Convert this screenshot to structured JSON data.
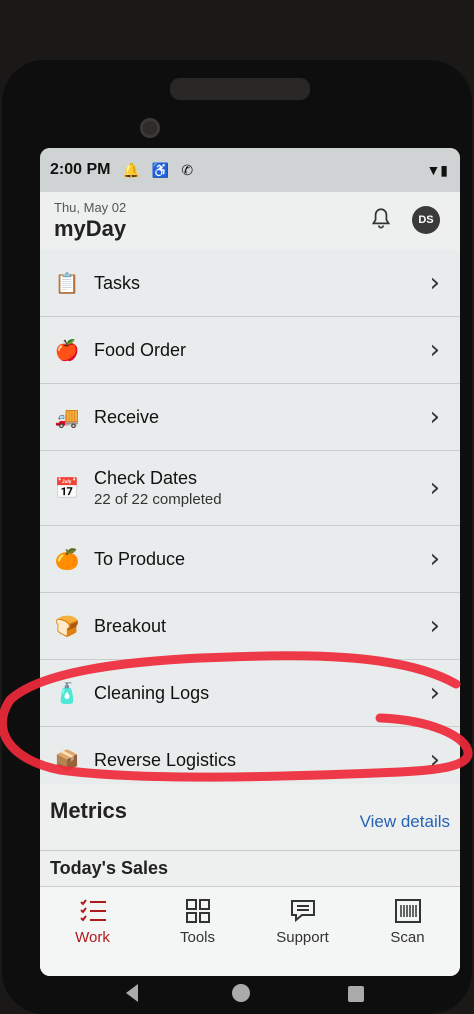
{
  "status": {
    "time": "2:00 PM",
    "icons": [
      "bell-icon",
      "accessibility-icon",
      "phone-icon"
    ],
    "right": "wifi-battery"
  },
  "header": {
    "date": "Thu, May 02",
    "title": "myDay",
    "avatar": "DS"
  },
  "menu": [
    {
      "label": "Tasks",
      "sub": "",
      "icon": "clipboard-icon"
    },
    {
      "label": "Food Order",
      "sub": "",
      "icon": "food-list-icon"
    },
    {
      "label": "Receive",
      "sub": "",
      "icon": "truck-icon"
    },
    {
      "label": "Check Dates",
      "sub": "22 of 22 completed",
      "icon": "calendar-icon"
    },
    {
      "label": "To Produce",
      "sub": "",
      "icon": "orange-icon"
    },
    {
      "label": "Breakout",
      "sub": "",
      "icon": "bread-icon"
    },
    {
      "label": "Cleaning Logs",
      "sub": "",
      "icon": "spray-bottle-icon"
    },
    {
      "label": "Reverse Logistics",
      "sub": "",
      "icon": "box-icon"
    }
  ],
  "metrics": {
    "title": "Metrics",
    "link": "View details",
    "sales_label": "Today's Sales"
  },
  "tabs": [
    {
      "label": "Work",
      "active": true
    },
    {
      "label": "Tools",
      "active": false
    },
    {
      "label": "Support",
      "active": false
    },
    {
      "label": "Scan",
      "active": false
    }
  ],
  "colors": {
    "accent": "#b01a1a",
    "link": "#2563b6",
    "annotation": "#ee2a3a"
  }
}
